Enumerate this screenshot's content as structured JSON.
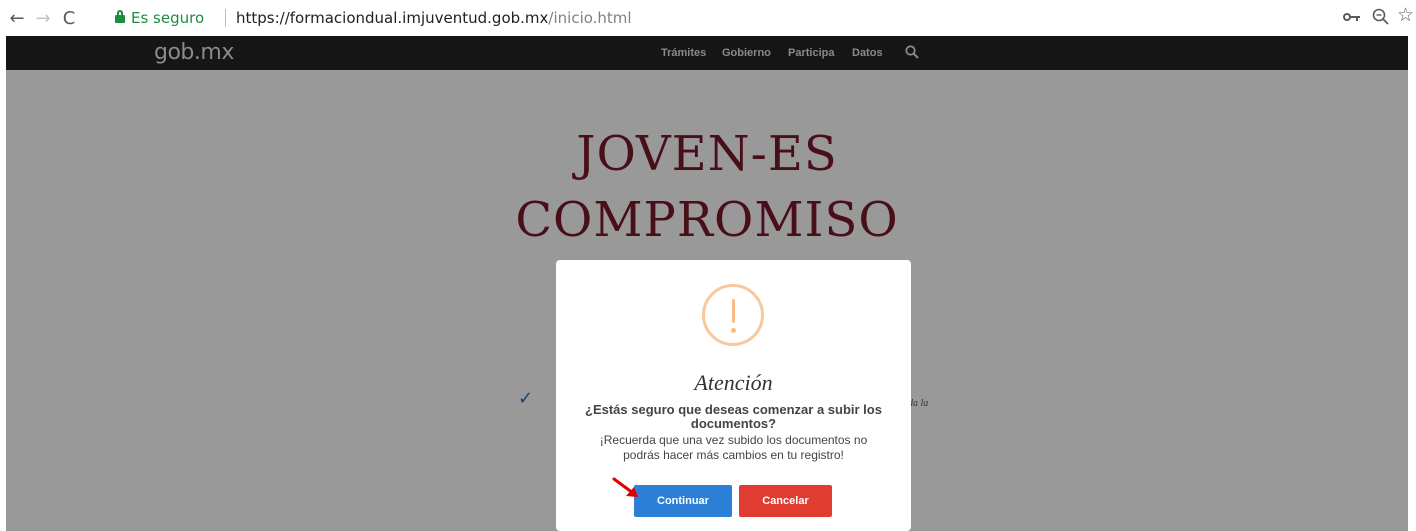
{
  "browser": {
    "back_glyph": "←",
    "forward_glyph": "→",
    "reload_glyph": "C",
    "secure_label": "Es seguro",
    "url_host": "https://formaciondual.imjuventud.gob.mx",
    "url_path": "/inicio.html",
    "star_glyph": "☆",
    "icons": [
      "back-icon",
      "forward-icon",
      "reload-icon",
      "lock-icon",
      "key-icon",
      "zoom-icon",
      "star-icon"
    ]
  },
  "site_nav": {
    "logo": "gob.mx",
    "links": [
      "Trámites",
      "Gobierno",
      "Participa",
      "Datos"
    ],
    "search_icon": "search-icon"
  },
  "page": {
    "hero_line1": "JOVEN-ES",
    "hero_line2": "COMPROMISO",
    "check_glyph": "✓",
    "side_text": "da la"
  },
  "modal": {
    "icon": "warning-icon",
    "title": "Atención",
    "question": "¿Estás seguro que deseas comenzar a subir los documentos?",
    "note": "¡Recuerda que una vez subido los documentos no podrás hacer más cambios en tu registro!",
    "continue_label": "Continuar",
    "cancel_label": "Cancelar"
  },
  "colors": {
    "continue": "#2b7fd6",
    "cancel": "#e03c31",
    "secure": "#1e8e3e",
    "hero": "#7a1a2a",
    "warning": "#f8bb86",
    "annotation_arrow": "#e00000"
  }
}
